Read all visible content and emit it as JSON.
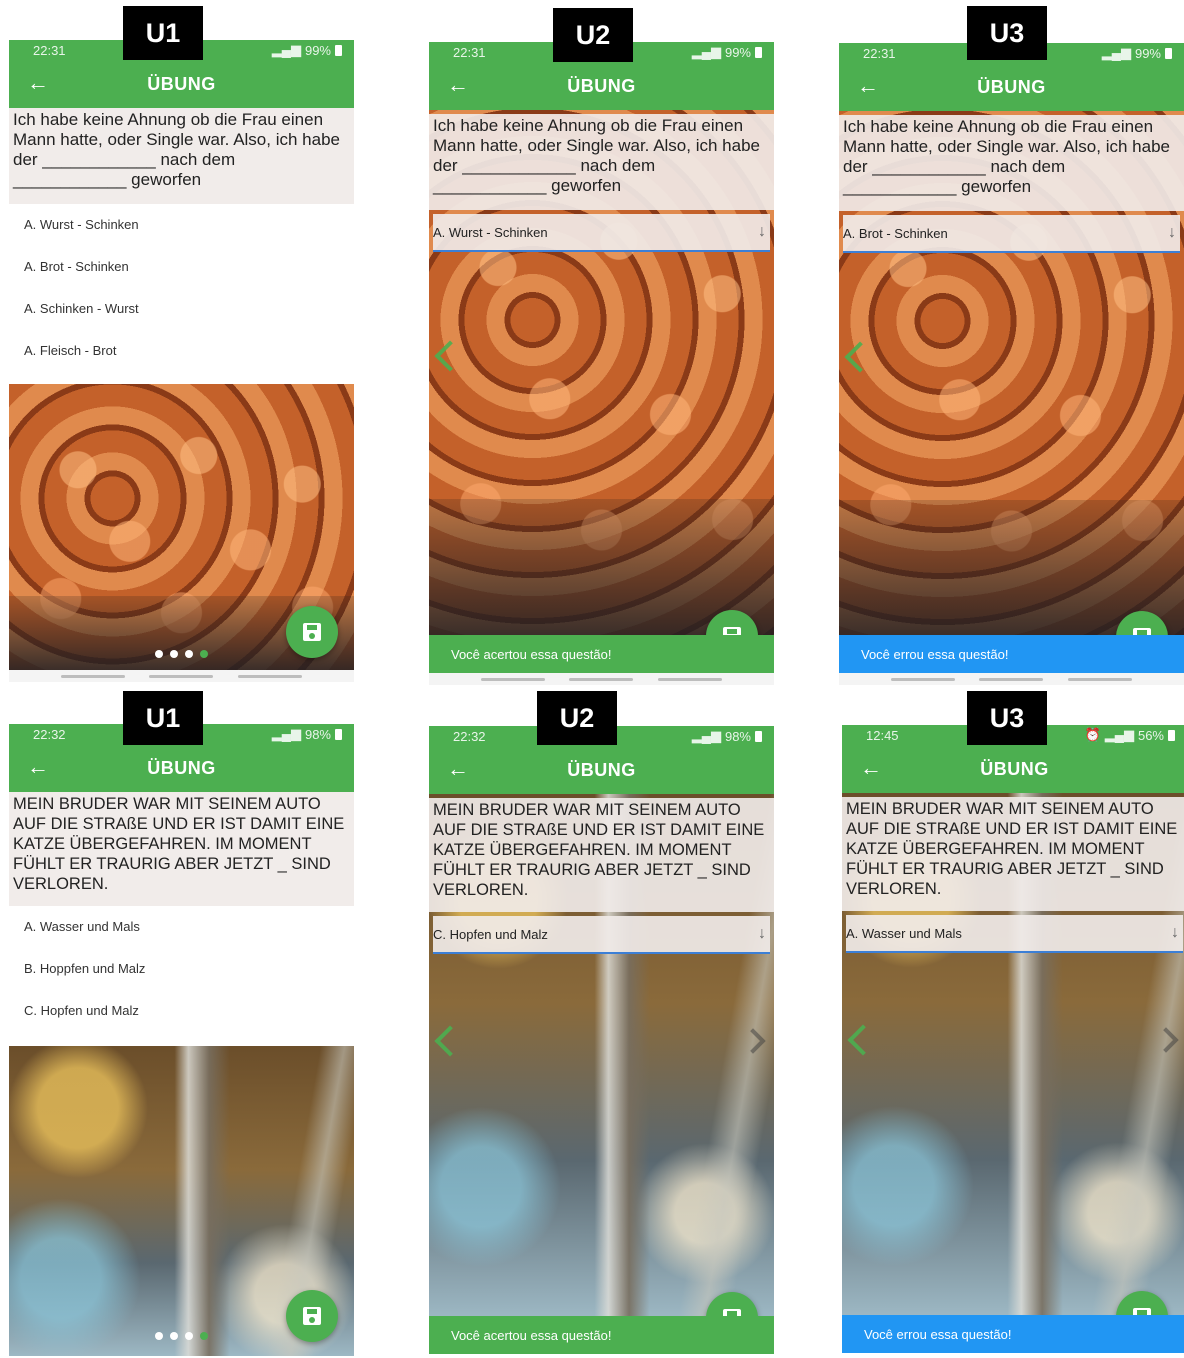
{
  "app": {
    "title": "ÜBUNG",
    "back_icon": "arrow-left-icon"
  },
  "colors": {
    "primary": "#4caf50",
    "error_snackbar": "#2196f3",
    "select_underline": "#3c7fd6"
  },
  "questions": {
    "q1": "Ich habe keine Ahnung ob die Frau einen Mann hatte, oder Single war. Also, ich habe der ____________ nach dem ____________ geworfen",
    "q2": "MEIN BRUDER WAR MIT SEINEM AUTO AUF DIE STRAßE UND ER IST DAMIT EINE KATZE ÜBERGEFAHREN. IM MOMENT FÜHLT ER TRAURIG ABER JETZT _ SIND VERLOREN."
  },
  "screens": [
    {
      "tag": "U1",
      "status": {
        "time": "22:31",
        "battery": "99%"
      },
      "options": [
        "A. Wurst - Schinken",
        "A. Brot - Schinken",
        "A. Schinken - Wurst",
        "A. Fleisch - Brot"
      ]
    },
    {
      "tag": "U2",
      "status": {
        "time": "22:31",
        "battery": "99%"
      },
      "selected": "A. Wurst - Schinken",
      "feedback": "Você acertou essa questão!"
    },
    {
      "tag": "U3",
      "status": {
        "time": "22:31",
        "battery": "99%"
      },
      "selected": "A. Brot - Schinken",
      "feedback": "Você errou essa questão!"
    },
    {
      "tag": "U1",
      "status": {
        "time": "22:32",
        "battery": "98%"
      },
      "options": [
        "A. Wasser und Mals",
        "B. Hoppfen und Malz",
        "C. Hopfen und Malz"
      ]
    },
    {
      "tag": "U2",
      "status": {
        "time": "22:32",
        "battery": "98%"
      },
      "selected": "C. Hopfen und Malz",
      "feedback": "Você acertou essa questão!"
    },
    {
      "tag": "U3",
      "status": {
        "time": "12:45",
        "battery": "56%"
      },
      "selected": "A. Wasser und Mals",
      "feedback": "Você errou essa questão!"
    }
  ]
}
